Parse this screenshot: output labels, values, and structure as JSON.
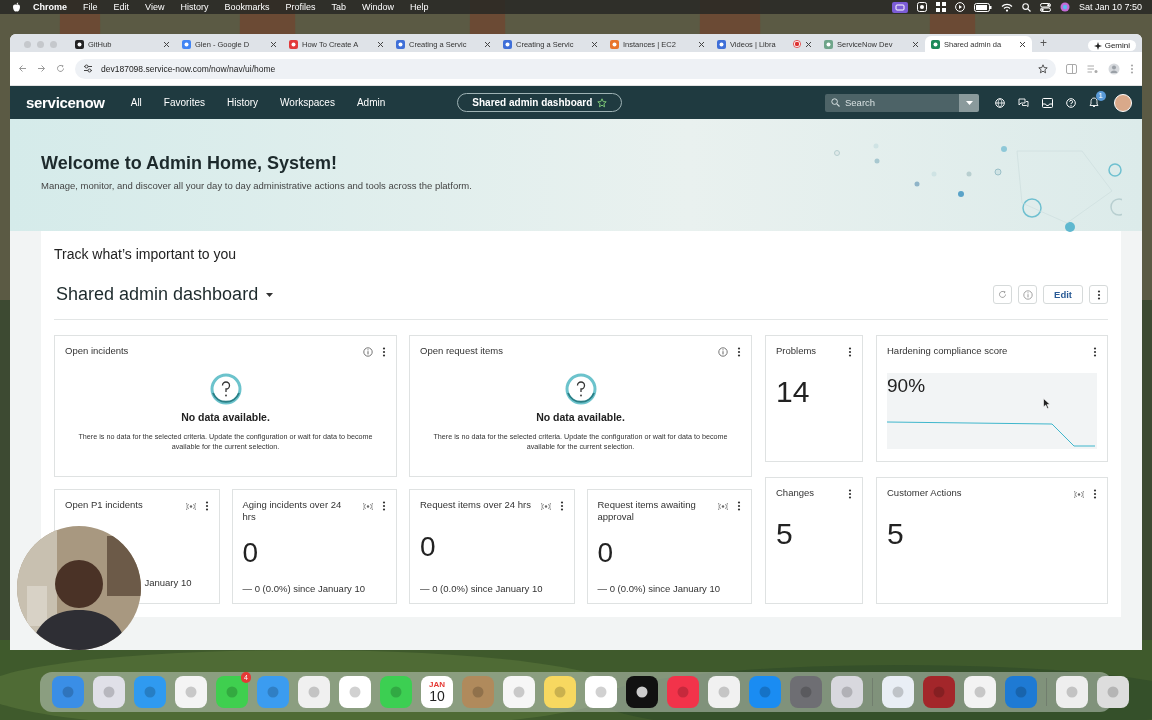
{
  "menubar": {
    "app": "Chrome",
    "items": [
      "File",
      "Edit",
      "View",
      "History",
      "Bookmarks",
      "Profiles",
      "Tab",
      "Window",
      "Help"
    ],
    "clock": "Sat Jan 10  7:50"
  },
  "browser": {
    "tabs": [
      {
        "title": "GitHub",
        "selected": false
      },
      {
        "title": "Glen - Google D",
        "selected": false
      },
      {
        "title": "How To Create A",
        "selected": false
      },
      {
        "title": "Creating a Servic",
        "selected": false
      },
      {
        "title": "Creating a Servic",
        "selected": false
      },
      {
        "title": "Instances | EC2",
        "selected": false
      },
      {
        "title": "Videos | Libra",
        "selected": false,
        "recording": true
      },
      {
        "title": "ServiceNow Dev",
        "selected": false
      },
      {
        "title": "Shared admin da",
        "selected": true
      }
    ],
    "new_tab": "+",
    "gemini": "Gemini",
    "url": "dev187098.service-now.com/now/nav/ui/home"
  },
  "header": {
    "logo": "servicenow",
    "nav": [
      "All",
      "Favorites",
      "History",
      "Workspaces",
      "Admin"
    ],
    "context": "Shared admin dashboard",
    "search": {
      "placeholder": "Search"
    },
    "notifications": "1"
  },
  "hero": {
    "title": "Welcome to Admin Home, System!",
    "subtitle": "Manage, monitor, and discover all your day to day administrative actions and tools across the platform."
  },
  "dashboard": {
    "heading": "Track what’s important to you",
    "title": "Shared admin dashboard",
    "edit": "Edit",
    "left_widgets": [
      {
        "kind": "empty",
        "title": "Open incidents",
        "message": "No data available.",
        "detail": "There is no data for the selected criteria. Update the configuration or wait for data to become available for the current selection."
      },
      {
        "kind": "empty",
        "title": "Open request items",
        "message": "No data available.",
        "detail": "There is no data for the selected criteria. Update the configuration or wait for data to become available for the current selection."
      },
      {
        "kind": "trend",
        "title": "Open P1 incidents",
        "change": "January 10"
      },
      {
        "kind": "trend",
        "title": "Aging incidents over 24 hrs",
        "value": "0",
        "change": "— 0 (0.0%) since January 10"
      },
      {
        "kind": "trend",
        "title": "Request items over 24 hrs",
        "value": "0",
        "change": "— 0 (0.0%) since January 10"
      },
      {
        "kind": "trend",
        "title": "Request items awaiting approval",
        "value": "0",
        "change": "— 0 (0.0%) since January 10"
      }
    ],
    "right_widgets": [
      {
        "kind": "count",
        "title": "Problems",
        "value": "14"
      },
      {
        "kind": "compliance",
        "title": "Hardening compliance score",
        "value": "90%"
      },
      {
        "kind": "count",
        "title": "Changes",
        "value": "5"
      },
      {
        "kind": "livecount",
        "title": "Customer Actions",
        "value": "5"
      }
    ]
  },
  "dock": {
    "messages_badge": "4",
    "calendar_month": "JAN",
    "calendar_day": "10"
  }
}
